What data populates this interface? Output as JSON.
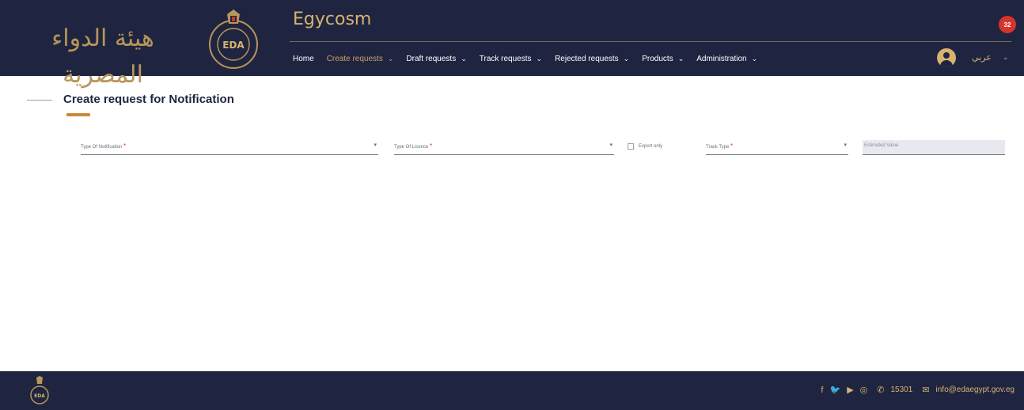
{
  "header": {
    "logo_text": "هيئة الدواء المصرية",
    "app_title": "Egycosm",
    "notification_count": "32",
    "language": "عربي",
    "nav": [
      {
        "label": "Home",
        "active": false,
        "dropdown": false
      },
      {
        "label": "Create requests",
        "active": true,
        "dropdown": true
      },
      {
        "label": "Draft requests",
        "active": false,
        "dropdown": true
      },
      {
        "label": "Track requests",
        "active": false,
        "dropdown": true
      },
      {
        "label": "Rejected requests",
        "active": false,
        "dropdown": true
      },
      {
        "label": "Products",
        "active": false,
        "dropdown": true
      },
      {
        "label": "Administration",
        "active": false,
        "dropdown": true
      }
    ]
  },
  "page": {
    "title": "Create request for Notification"
  },
  "form": {
    "type_of_notification": "Type Of Notification",
    "type_of_licence": "Type Of Licence",
    "export_only": "Export only",
    "track_type": "Track Type",
    "estimated_value": "Estimated Value",
    "required_mark": "*"
  },
  "footer": {
    "phone": "15301",
    "email": "info@edaegypt.gov.eg"
  },
  "colors": {
    "navy": "#1f2540",
    "gold": "#d7b36f",
    "accent": "#c8893a",
    "badge": "#d7342b"
  }
}
